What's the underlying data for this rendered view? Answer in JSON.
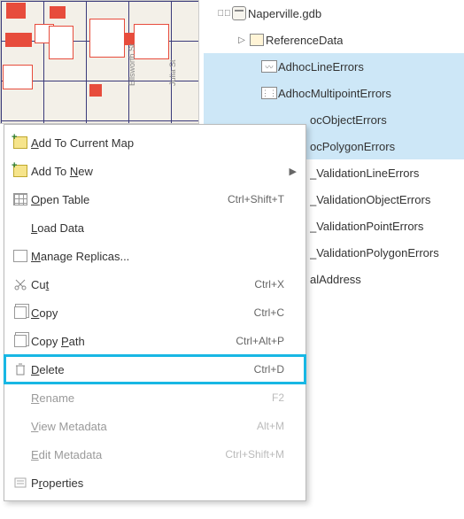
{
  "map": {
    "street_labels": [
      "Ellsworth St",
      "Julia St"
    ]
  },
  "tree": {
    "root": {
      "label": "Naperville.gdb"
    },
    "dataset": {
      "label": "ReferenceData"
    },
    "items": [
      {
        "label": "AdhocLineErrors",
        "selected": true
      },
      {
        "label": "AdhocMultipointErrors",
        "selected": true
      },
      {
        "label": "ocObjectErrors",
        "selected": true,
        "clipped_prefix": true
      },
      {
        "label": "ocPolygonErrors",
        "selected": true,
        "clipped_prefix": true
      },
      {
        "label": "_ValidationLineErrors",
        "selected": false,
        "clipped_prefix": true
      },
      {
        "label": "_ValidationObjectErrors",
        "selected": false,
        "clipped_prefix": true
      },
      {
        "label": "_ValidationPointErrors",
        "selected": false,
        "clipped_prefix": true
      },
      {
        "label": "_ValidationPolygonErrors",
        "selected": false,
        "clipped_prefix": true
      },
      {
        "label": "alAddress",
        "selected": false,
        "clipped_prefix": true
      }
    ]
  },
  "menu": {
    "items": [
      {
        "id": "add-to-map",
        "pre": "",
        "u": "A",
        "post": "dd To Current Map",
        "shortcut": "",
        "icon": "plus-map",
        "submenu": false,
        "disabled": false
      },
      {
        "id": "add-to-new",
        "pre": "Add To ",
        "u": "N",
        "post": "ew",
        "shortcut": "",
        "icon": "plus-new",
        "submenu": true,
        "disabled": false
      },
      {
        "id": "open-table",
        "pre": "",
        "u": "O",
        "post": "pen Table",
        "shortcut": "Ctrl+Shift+T",
        "icon": "table",
        "submenu": false,
        "disabled": false
      },
      {
        "id": "load-data",
        "pre": "",
        "u": "L",
        "post": "oad Data",
        "shortcut": "",
        "icon": "",
        "submenu": false,
        "disabled": false
      },
      {
        "id": "manage-repl",
        "pre": "",
        "u": "M",
        "post": "anage Replicas...",
        "shortcut": "",
        "icon": "replica",
        "submenu": false,
        "disabled": false
      },
      {
        "id": "cut",
        "pre": "Cu",
        "u": "t",
        "post": "",
        "shortcut": "Ctrl+X",
        "icon": "cut",
        "submenu": false,
        "disabled": false
      },
      {
        "id": "copy",
        "pre": "",
        "u": "C",
        "post": "opy",
        "shortcut": "Ctrl+C",
        "icon": "copy",
        "submenu": false,
        "disabled": false
      },
      {
        "id": "copy-path",
        "pre": "Copy ",
        "u": "P",
        "post": "ath",
        "shortcut": "Ctrl+Alt+P",
        "icon": "copy",
        "submenu": false,
        "disabled": false
      },
      {
        "id": "delete",
        "pre": "",
        "u": "D",
        "post": "elete",
        "shortcut": "Ctrl+D",
        "icon": "trash",
        "submenu": false,
        "disabled": false,
        "highlight": true
      },
      {
        "id": "rename",
        "pre": "",
        "u": "R",
        "post": "ename",
        "shortcut": "F2",
        "icon": "",
        "submenu": false,
        "disabled": true
      },
      {
        "id": "view-meta",
        "pre": "",
        "u": "V",
        "post": "iew Metadata",
        "shortcut": "Alt+M",
        "icon": "",
        "submenu": false,
        "disabled": true
      },
      {
        "id": "edit-meta",
        "pre": "",
        "u": "E",
        "post": "dit Metadata",
        "shortcut": "Ctrl+Shift+M",
        "icon": "",
        "submenu": false,
        "disabled": true
      },
      {
        "id": "properties",
        "pre": "P",
        "u": "r",
        "post": "operties",
        "shortcut": "",
        "icon": "props",
        "submenu": false,
        "disabled": false
      }
    ]
  }
}
